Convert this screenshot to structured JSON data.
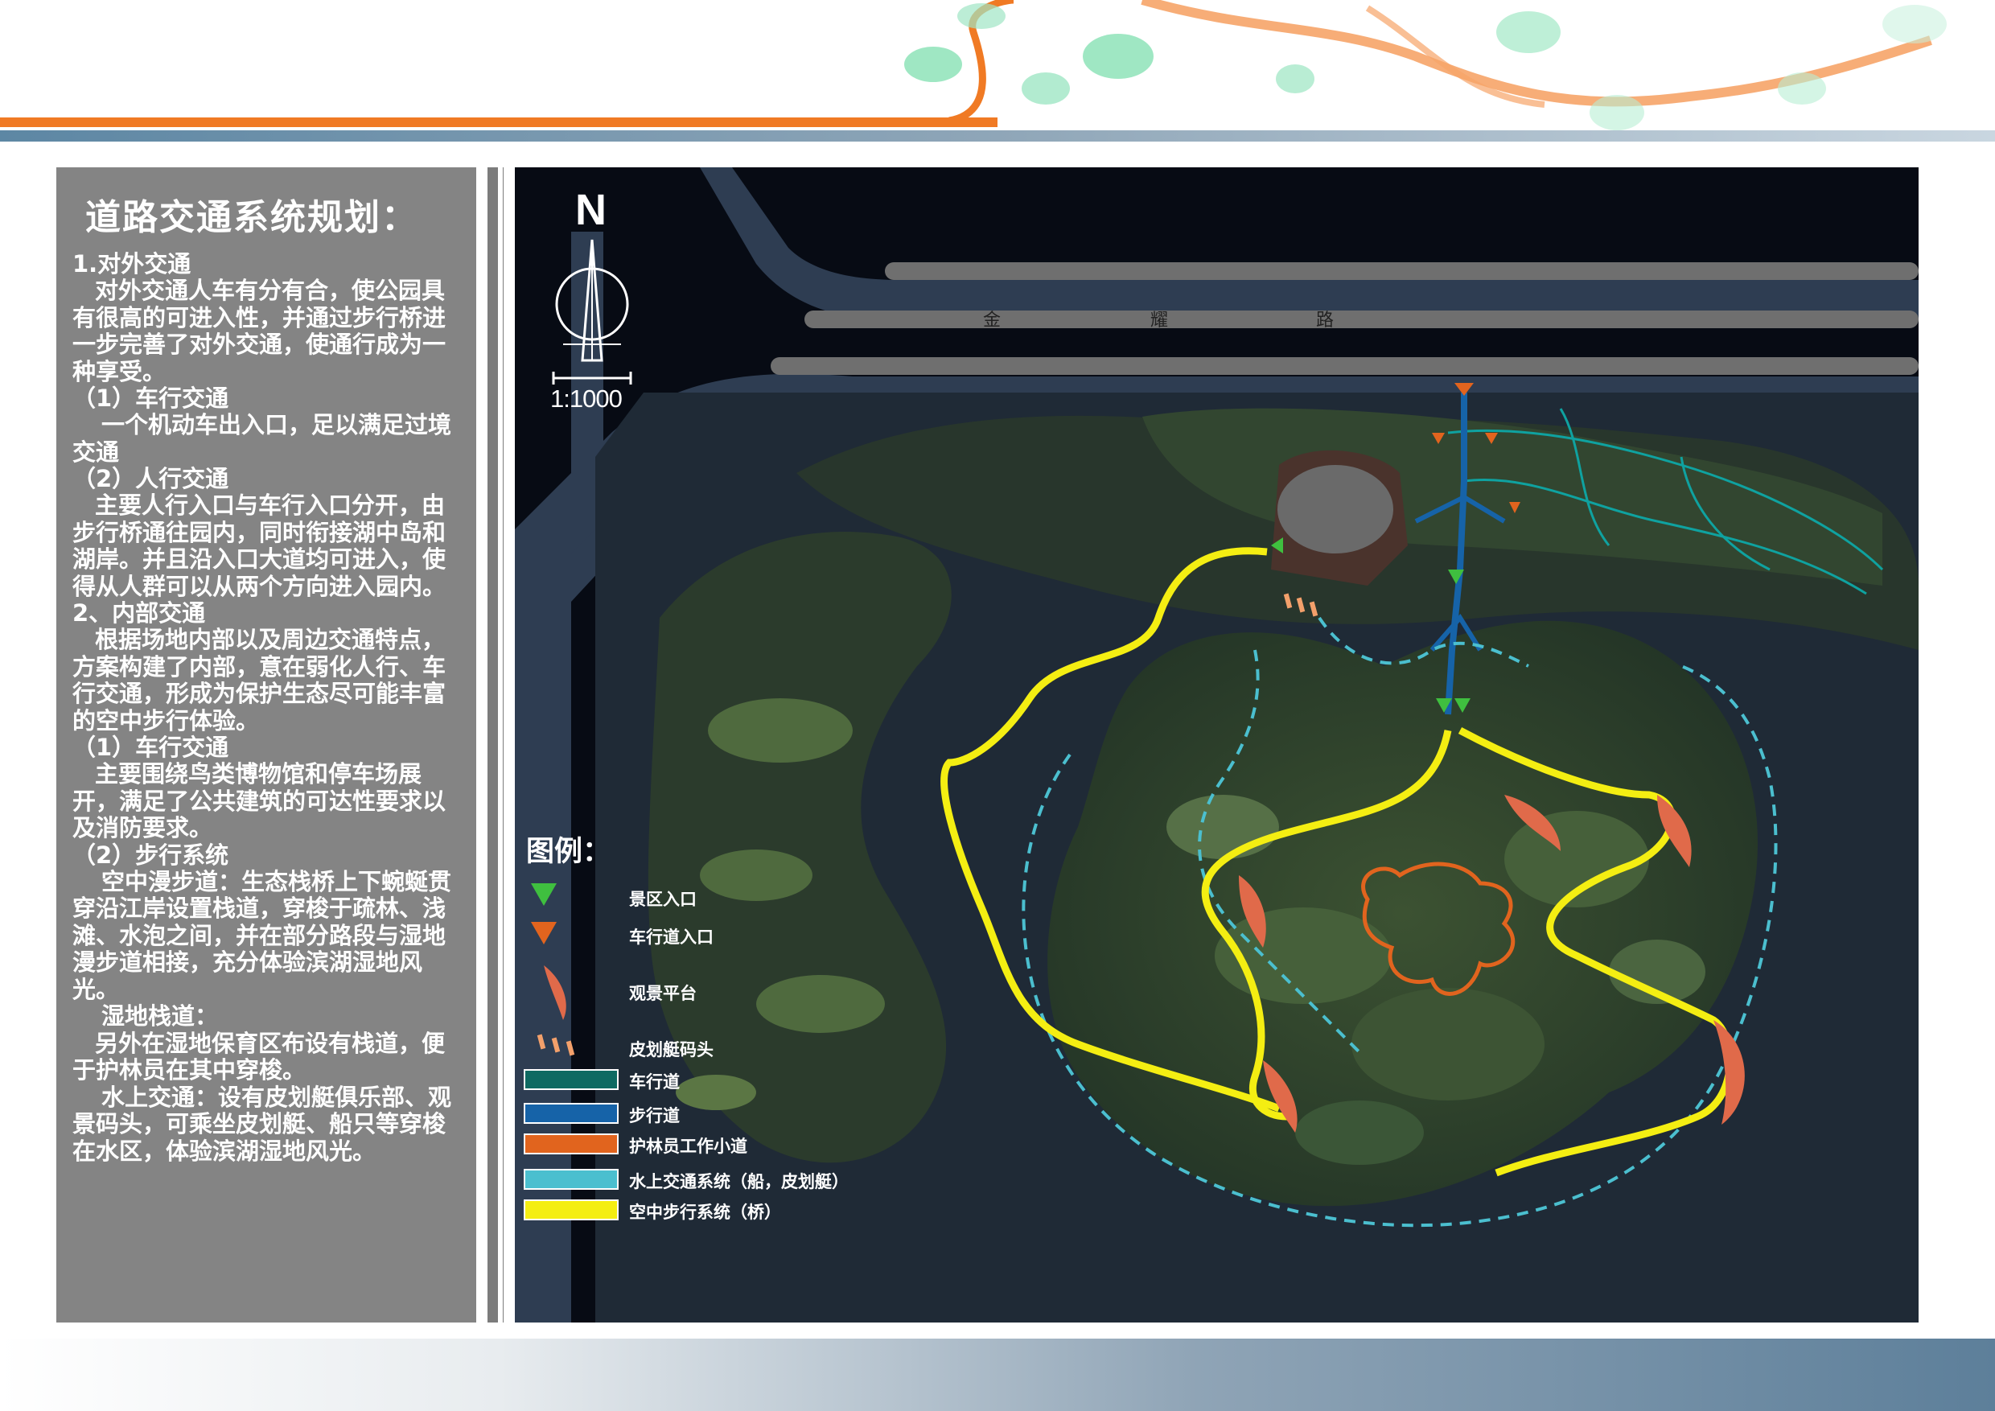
{
  "page": {
    "panel_title": "道路交通系统规划：",
    "scale": "1:1000",
    "north": "N",
    "road_name_chars": [
      "金",
      "耀",
      "路"
    ]
  },
  "text_blocks": [
    {
      "kind": "section",
      "text": "1.对外交通"
    },
    {
      "kind": "para",
      "text": "对外交通人车有分有合，使公园具有很高的可进入性，并通过步行桥进一步完善了对外交通，使通行成为一种享受。"
    },
    {
      "kind": "section",
      "text": "（1）车行交通"
    },
    {
      "kind": "para-deep",
      "text": "一个机动车出入口，足以满足过境交通"
    },
    {
      "kind": "section",
      "text": "（2）人行交通"
    },
    {
      "kind": "para",
      "text": "主要人行入口与车行入口分开，由步行桥通往园内，同时衔接湖中岛和湖岸。并且沿入口大道均可进入，使得从人群可以从两个方向进入园内。"
    },
    {
      "kind": "section",
      "text": "2、内部交通"
    },
    {
      "kind": "para",
      "text": "根据场地内部以及周边交通特点，方案构建了内部，意在弱化人行、车行交通，形成为保护生态尽可能丰富的空中步行体验。"
    },
    {
      "kind": "section",
      "text": "（1）车行交通"
    },
    {
      "kind": "para",
      "text": "主要围绕鸟类博物馆和停车场展开，满足了公共建筑的可达性要求以及消防要求。"
    },
    {
      "kind": "section",
      "text": "（2）步行系统"
    },
    {
      "kind": "para-deep",
      "text": "空中漫步道：生态栈桥上下蜿蜒贯穿沿江岸设置栈道，穿梭于疏林、浅滩、水泡之间，并在部分路段与湿地漫步道相接，充分体验滨湖湿地风光。"
    },
    {
      "kind": "para-deep",
      "text": "湿地栈道："
    },
    {
      "kind": "para",
      "text": "另外在湿地保育区布设有栈道，便于护林员在其中穿梭。"
    },
    {
      "kind": "para-deep",
      "text": "水上交通：设有皮划艇俱乐部、观景码头，可乘坐皮划艇、船只等穿梭在水区，体验滨湖湿地风光。"
    }
  ],
  "legend": {
    "title": "图例：",
    "items": [
      {
        "label": "景区入口",
        "icon": "green-triangle-icon",
        "color": "#3fbf3f"
      },
      {
        "label": "车行道入口",
        "icon": "orange-triangle-icon",
        "color": "#e2641e"
      },
      {
        "label": "观景平台",
        "icon": "viewing-platform-icon",
        "color": "#e06a4a"
      },
      {
        "label": "皮划艇码头",
        "icon": "kayak-dock-icon",
        "color": "#f3a06b"
      },
      {
        "label": "车行道",
        "icon": "teal-swatch",
        "color": "#0e6a62"
      },
      {
        "label": "步行道",
        "icon": "blue-swatch",
        "color": "#1663a8"
      },
      {
        "label": "护林员工作小道",
        "icon": "orange-swatch",
        "color": "#e1641e"
      },
      {
        "label": "水上交通系统（船，皮划艇）",
        "icon": "cyan-swatch",
        "color": "#4bbfcf"
      },
      {
        "label": "空中步行系统（桥）",
        "icon": "yellow-swatch",
        "color": "#f4ee12"
      }
    ]
  },
  "colors": {
    "panel_bg": "#848484",
    "map_bg": "#070b14",
    "sky_bridge": "#f4ee12",
    "walkway": "#1663a8",
    "driveway": "#0e6a62",
    "ranger_path": "#e1641e",
    "water_route": "#4bbfcf"
  }
}
